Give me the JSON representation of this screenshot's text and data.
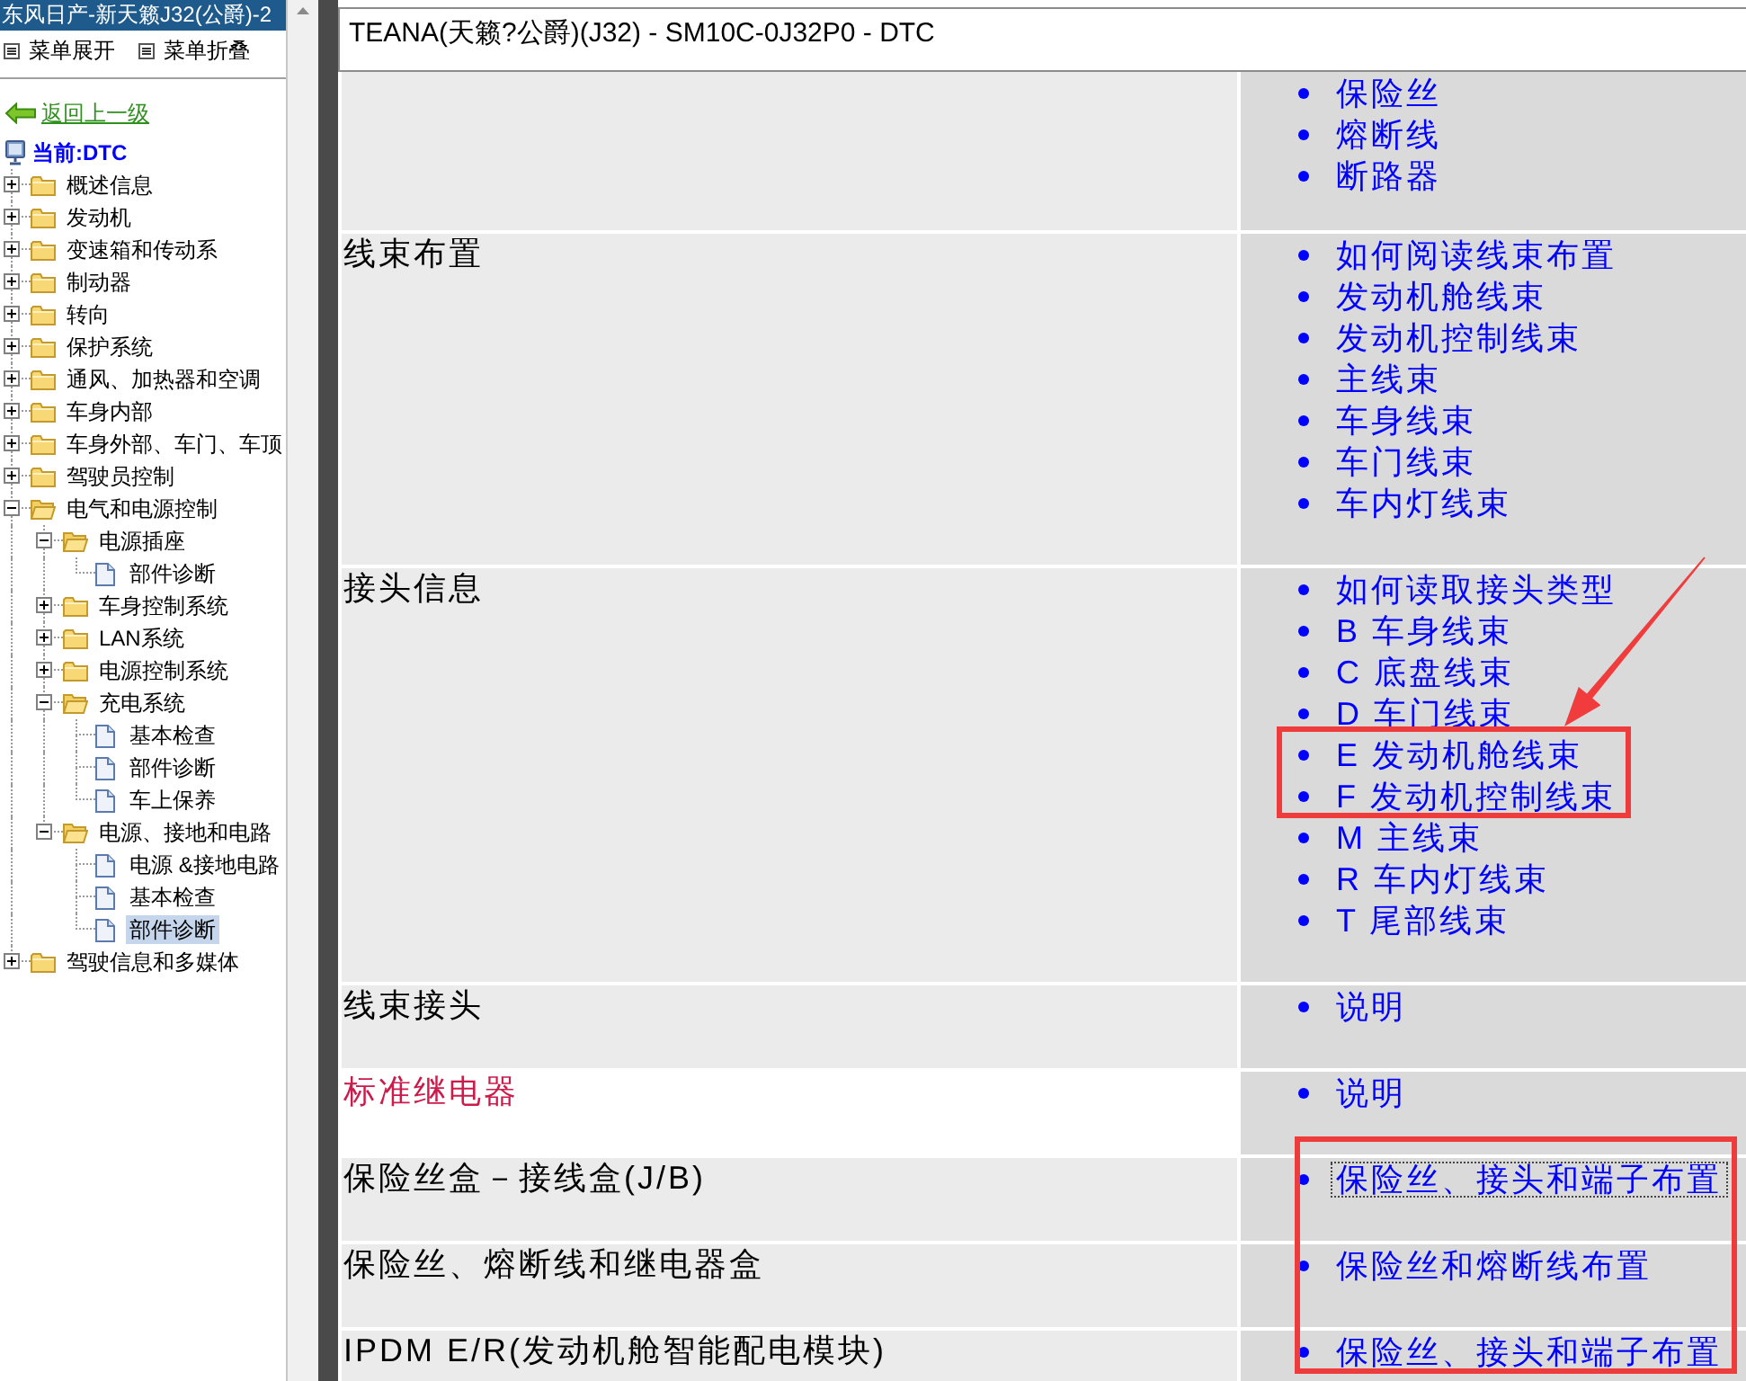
{
  "sidebar": {
    "title": "东风日产-新天籁J32(公爵)-2",
    "menu_buttons": [
      "菜单展开",
      "菜单折叠"
    ],
    "back_link": "返回上一级",
    "current": "当前:DTC",
    "tree": [
      {
        "label": "概述信息",
        "kind": "folder",
        "expanded": false,
        "selected": false
      },
      {
        "label": "发动机",
        "kind": "folder",
        "expanded": false,
        "selected": false
      },
      {
        "label": "变速箱和传动系",
        "kind": "folder",
        "expanded": false,
        "selected": false
      },
      {
        "label": "制动器",
        "kind": "folder",
        "expanded": false,
        "selected": false
      },
      {
        "label": "转向",
        "kind": "folder",
        "expanded": false,
        "selected": false
      },
      {
        "label": "保护系统",
        "kind": "folder",
        "expanded": false,
        "selected": false
      },
      {
        "label": "通风、加热器和空调",
        "kind": "folder",
        "expanded": false,
        "selected": false
      },
      {
        "label": "车身内部",
        "kind": "folder",
        "expanded": false,
        "selected": false
      },
      {
        "label": "车身外部、车门、车顶",
        "kind": "folder",
        "expanded": false,
        "selected": false
      },
      {
        "label": "驾驶员控制",
        "kind": "folder",
        "expanded": false,
        "selected": false
      },
      {
        "label": "电气和电源控制",
        "kind": "folder",
        "expanded": true,
        "selected": false,
        "children": [
          {
            "label": "电源插座",
            "kind": "folder",
            "expanded": true,
            "selected": false,
            "children": [
              {
                "label": "部件诊断",
                "kind": "page",
                "selected": false
              }
            ]
          },
          {
            "label": "车身控制系统",
            "kind": "folder",
            "expanded": false,
            "selected": false
          },
          {
            "label": "LAN系统",
            "kind": "folder",
            "expanded": false,
            "selected": false
          },
          {
            "label": "电源控制系统",
            "kind": "folder",
            "expanded": false,
            "selected": false
          },
          {
            "label": "充电系统",
            "kind": "folder",
            "expanded": true,
            "selected": false,
            "children": [
              {
                "label": "基本检查",
                "kind": "page",
                "selected": false
              },
              {
                "label": "部件诊断",
                "kind": "page",
                "selected": false
              },
              {
                "label": "车上保养",
                "kind": "page",
                "selected": false
              }
            ]
          },
          {
            "label": "电源、接地和电路",
            "kind": "folder",
            "expanded": true,
            "selected": false,
            "children": [
              {
                "label": "电源 &接地电路",
                "kind": "page",
                "selected": false
              },
              {
                "label": "基本检查",
                "kind": "page",
                "selected": false
              },
              {
                "label": "部件诊断",
                "kind": "page",
                "selected": true
              }
            ]
          }
        ]
      },
      {
        "label": "驾驶信息和多媒体",
        "kind": "folder",
        "expanded": false,
        "selected": false
      }
    ]
  },
  "header": {
    "title": "TEANA(天籁?公爵)(J32) - SM10C-0J32P0 - DTC"
  },
  "table": {
    "rows": [
      {
        "hovered": false,
        "links": [
          {
            "text": "保险丝",
            "focused": false
          },
          {
            "text": "熔断线",
            "focused": false
          },
          {
            "text": "断路器",
            "focused": false
          }
        ]
      },
      {
        "label": "线束布置",
        "hovered": false,
        "links": [
          {
            "text": "如何阅读线束布置",
            "focused": false
          },
          {
            "text": "发动机舱线束",
            "focused": false
          },
          {
            "text": "发动机控制线束",
            "focused": false
          },
          {
            "text": "主线束",
            "focused": false
          },
          {
            "text": "车身线束",
            "focused": false
          },
          {
            "text": "车门线束",
            "focused": false
          },
          {
            "text": "车内灯线束",
            "focused": false
          }
        ]
      },
      {
        "label": "接头信息",
        "hovered": false,
        "links": [
          {
            "text": "如何读取接头类型",
            "focused": false
          },
          {
            "text": "B 车身线束",
            "focused": false
          },
          {
            "text": "C 底盘线束",
            "focused": false
          },
          {
            "text": "D 车门线束",
            "focused": false
          },
          {
            "text": "E 发动机舱线束",
            "focused": false
          },
          {
            "text": "F 发动机控制线束",
            "focused": false
          },
          {
            "text": "M 主线束",
            "focused": false
          },
          {
            "text": "R 车内灯线束",
            "focused": false
          },
          {
            "text": "T 尾部线束",
            "focused": false
          }
        ]
      },
      {
        "label": "线束接头",
        "hovered": false,
        "links": [
          {
            "text": "说明",
            "focused": false
          }
        ]
      },
      {
        "label": "标准继电器",
        "hovered": true,
        "links": [
          {
            "text": "说明",
            "focused": false
          }
        ]
      },
      {
        "label": "保险丝盒－接线盒(J/B)",
        "hovered": false,
        "links": [
          {
            "text": "保险丝、接头和端子布置",
            "focused": true
          }
        ]
      },
      {
        "label": "保险丝、熔断线和继电器盒",
        "hovered": false,
        "links": [
          {
            "text": "保险丝和熔断线布置",
            "focused": false
          }
        ]
      },
      {
        "label": "IPDM E/R(发动机舱智能配电模块)",
        "hovered": false,
        "links": [
          {
            "text": "保险丝、接头和端子布置",
            "focused": false
          }
        ]
      }
    ]
  },
  "annotations": [
    {
      "kind": "frame"
    },
    {
      "kind": "arrow"
    },
    {
      "kind": "frame"
    }
  ]
}
